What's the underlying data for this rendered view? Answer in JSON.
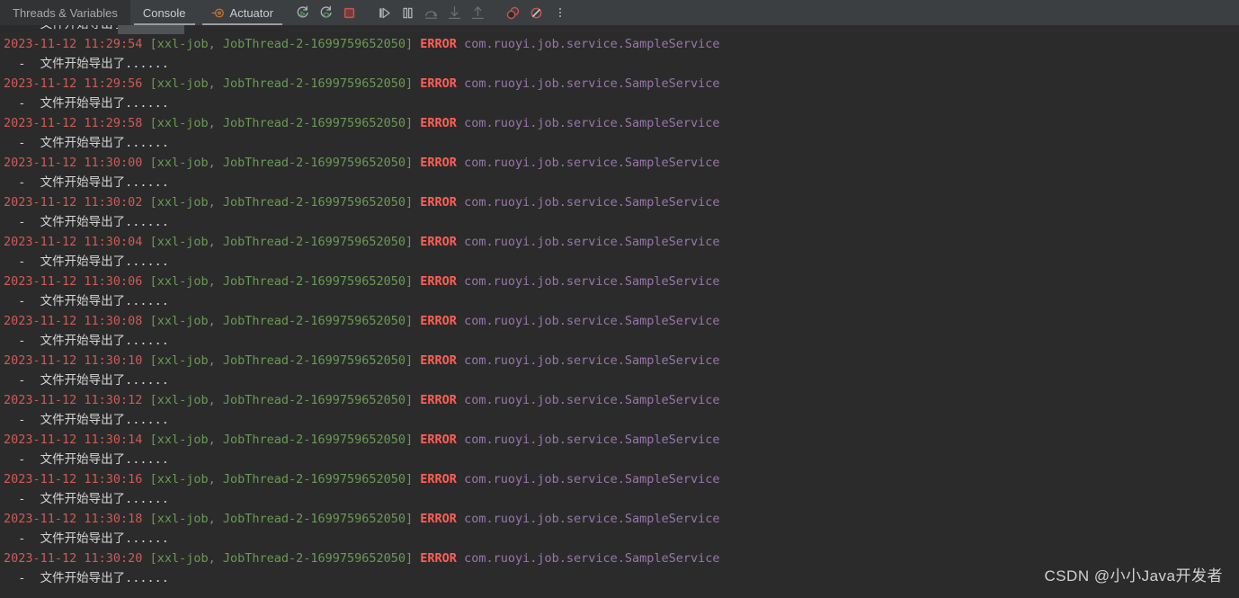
{
  "toolbar": {
    "tabs": [
      {
        "label": "Threads & Variables",
        "active": false,
        "icon": null
      },
      {
        "label": "Console",
        "active": true,
        "icon": null
      },
      {
        "label": "Actuator",
        "active": false,
        "icon": "actuator-icon"
      }
    ],
    "buttons": [
      {
        "name": "rerun-button",
        "label": "Rerun",
        "disabled": false
      },
      {
        "name": "rerun-debug-button",
        "label": "Rerun Debug",
        "disabled": false
      },
      {
        "name": "stop-button",
        "label": "Stop",
        "disabled": false
      },
      {
        "name": "resume-program-button",
        "label": "Resume Program",
        "disabled": false
      },
      {
        "name": "pause-program-button",
        "label": "Pause Program",
        "disabled": false
      },
      {
        "name": "step-over-button",
        "label": "Step Over",
        "disabled": true
      },
      {
        "name": "step-into-button",
        "label": "Step Into",
        "disabled": true
      },
      {
        "name": "step-out-button",
        "label": "Step Out",
        "disabled": true
      },
      {
        "name": "mute-breakpoints-button",
        "label": "Mute Breakpoints",
        "disabled": false
      },
      {
        "name": "view-breakpoints-button",
        "label": "View Breakpoints",
        "disabled": false
      },
      {
        "name": "more-options-button",
        "label": "More",
        "disabled": false
      }
    ]
  },
  "colors": {
    "background": "#2b2b2b",
    "toolbar_background": "#3c3f41",
    "timestamp": "#cf5b56",
    "thread": "#6a9955",
    "error": "#ff5f56",
    "logger": "#9876aa",
    "message": "#d4d4d4",
    "stop_red": "#c75450",
    "accent_green": "#499c54",
    "actuator_orange": "#cc7832"
  },
  "console": {
    "log_template": {
      "date": "2023-11-12",
      "thread_prefix": "[xxl-job, JobThread-2-1699759652050]",
      "level": "ERROR",
      "logger": "com.ruoyi.job.service.SampleService",
      "message": "  -  文件开始导出了......"
    },
    "lines": [
      {
        "type": "message",
        "text": "  -  文件开始导出了......",
        "clipped": true
      },
      {
        "type": "error",
        "timestamp": "2023-11-12 11:29:54",
        "thread": " [xxl-job, JobThread-2-1699759652050] ",
        "level": "ERROR",
        "logger": " com.ruoyi.job.service.SampleService"
      },
      {
        "type": "message",
        "text": "  -  文件开始导出了......"
      },
      {
        "type": "error",
        "timestamp": "2023-11-12 11:29:56",
        "thread": " [xxl-job, JobThread-2-1699759652050] ",
        "level": "ERROR",
        "logger": " com.ruoyi.job.service.SampleService"
      },
      {
        "type": "message",
        "text": "  -  文件开始导出了......"
      },
      {
        "type": "error",
        "timestamp": "2023-11-12 11:29:58",
        "thread": " [xxl-job, JobThread-2-1699759652050] ",
        "level": "ERROR",
        "logger": " com.ruoyi.job.service.SampleService"
      },
      {
        "type": "message",
        "text": "  -  文件开始导出了......"
      },
      {
        "type": "error",
        "timestamp": "2023-11-12 11:30:00",
        "thread": " [xxl-job, JobThread-2-1699759652050] ",
        "level": "ERROR",
        "logger": " com.ruoyi.job.service.SampleService"
      },
      {
        "type": "message",
        "text": "  -  文件开始导出了......"
      },
      {
        "type": "error",
        "timestamp": "2023-11-12 11:30:02",
        "thread": " [xxl-job, JobThread-2-1699759652050] ",
        "level": "ERROR",
        "logger": " com.ruoyi.job.service.SampleService"
      },
      {
        "type": "message",
        "text": "  -  文件开始导出了......"
      },
      {
        "type": "error",
        "timestamp": "2023-11-12 11:30:04",
        "thread": " [xxl-job, JobThread-2-1699759652050] ",
        "level": "ERROR",
        "logger": " com.ruoyi.job.service.SampleService"
      },
      {
        "type": "message",
        "text": "  -  文件开始导出了......"
      },
      {
        "type": "error",
        "timestamp": "2023-11-12 11:30:06",
        "thread": " [xxl-job, JobThread-2-1699759652050] ",
        "level": "ERROR",
        "logger": " com.ruoyi.job.service.SampleService"
      },
      {
        "type": "message",
        "text": "  -  文件开始导出了......"
      },
      {
        "type": "error",
        "timestamp": "2023-11-12 11:30:08",
        "thread": " [xxl-job, JobThread-2-1699759652050] ",
        "level": "ERROR",
        "logger": " com.ruoyi.job.service.SampleService"
      },
      {
        "type": "message",
        "text": "  -  文件开始导出了......"
      },
      {
        "type": "error",
        "timestamp": "2023-11-12 11:30:10",
        "thread": " [xxl-job, JobThread-2-1699759652050] ",
        "level": "ERROR",
        "logger": " com.ruoyi.job.service.SampleService"
      },
      {
        "type": "message",
        "text": "  -  文件开始导出了......"
      },
      {
        "type": "error",
        "timestamp": "2023-11-12 11:30:12",
        "thread": " [xxl-job, JobThread-2-1699759652050] ",
        "level": "ERROR",
        "logger": " com.ruoyi.job.service.SampleService"
      },
      {
        "type": "message",
        "text": "  -  文件开始导出了......"
      },
      {
        "type": "error",
        "timestamp": "2023-11-12 11:30:14",
        "thread": " [xxl-job, JobThread-2-1699759652050] ",
        "level": "ERROR",
        "logger": " com.ruoyi.job.service.SampleService"
      },
      {
        "type": "message",
        "text": "  -  文件开始导出了......"
      },
      {
        "type": "error",
        "timestamp": "2023-11-12 11:30:16",
        "thread": " [xxl-job, JobThread-2-1699759652050] ",
        "level": "ERROR",
        "logger": " com.ruoyi.job.service.SampleService"
      },
      {
        "type": "message",
        "text": "  -  文件开始导出了......"
      },
      {
        "type": "error",
        "timestamp": "2023-11-12 11:30:18",
        "thread": " [xxl-job, JobThread-2-1699759652050] ",
        "level": "ERROR",
        "logger": " com.ruoyi.job.service.SampleService"
      },
      {
        "type": "message",
        "text": "  -  文件开始导出了......"
      },
      {
        "type": "error",
        "timestamp": "2023-11-12 11:30:20",
        "thread": " [xxl-job, JobThread-2-1699759652050] ",
        "level": "ERROR",
        "logger": " com.ruoyi.job.service.SampleService"
      },
      {
        "type": "message",
        "text": "  -  文件开始导出了......",
        "clipped": true
      }
    ]
  },
  "watermark": {
    "text": "CSDN @小小Java开发者"
  }
}
